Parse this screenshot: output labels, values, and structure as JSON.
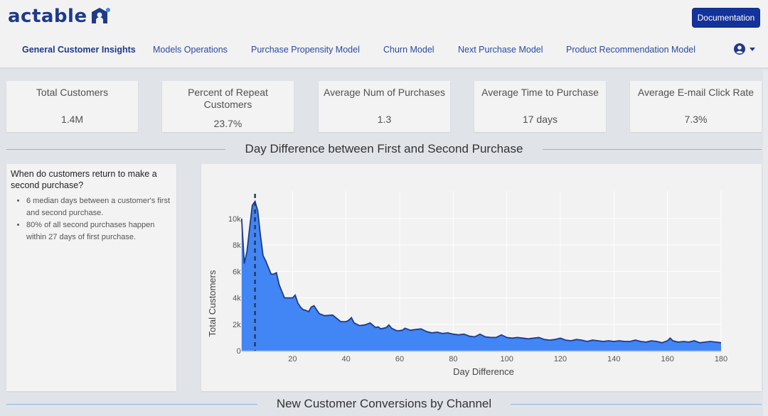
{
  "header": {
    "logo_text": "actable",
    "logo_icon": "house-person-icon",
    "documentation_label": "Documentation",
    "brand_color": "#1e3a8a",
    "button_color": "#14339a"
  },
  "nav": {
    "items": [
      {
        "label": "General Customer Insights",
        "active": true
      },
      {
        "label": "Models Operations",
        "active": false
      },
      {
        "label": "Purchase Propensity Model",
        "active": false
      },
      {
        "label": "Churn Model",
        "active": false
      },
      {
        "label": "Next Purchase Model",
        "active": false
      },
      {
        "label": "Product Recommendation Model",
        "active": false
      }
    ],
    "user_icon": "user-circle-icon"
  },
  "kpis": [
    {
      "title": "Total Customers",
      "value": "1.4M"
    },
    {
      "title": "Percent of Repeat Customers",
      "value": "23.7%"
    },
    {
      "title": "Average Num of Purchases",
      "value": "1.3"
    },
    {
      "title": "Average Time to Purchase",
      "value": "17 days"
    },
    {
      "title": "Average E-mail Click Rate",
      "value": "7.3%"
    }
  ],
  "sections": {
    "day_difference_title": "Day Difference between First and Second Purchase",
    "conversions_title": "New Customer Conversions by Channel"
  },
  "insights": {
    "question": "When do customers return to make a second purchase?",
    "bullets": [
      "6 median days between a customer's first and second purchase.",
      "80% of all second purchases happen within 27 days of first purchase."
    ]
  },
  "chart_data": {
    "type": "area",
    "title": "Day Difference between First and Second Purchase",
    "xlabel": "Day Difference",
    "ylabel": "Total Customers",
    "xlim": [
      0,
      180
    ],
    "ylim": [
      0,
      11500
    ],
    "x_ticks": [
      20,
      40,
      60,
      80,
      100,
      120,
      140,
      160,
      180
    ],
    "y_ticks": [
      0,
      2000,
      4000,
      6000,
      8000,
      10000
    ],
    "y_tick_labels": [
      "0",
      "2k",
      "4k",
      "6k",
      "8k",
      "10k"
    ],
    "grid": true,
    "fill_color": "#4285f4",
    "line_color": "#1e3a8a",
    "median_line": {
      "x": 6,
      "style": "dashed",
      "color": "#2b3a55"
    },
    "series": [
      {
        "name": "Total Customers",
        "x": [
          1,
          2,
          3,
          4,
          5,
          6,
          7,
          8,
          9,
          10,
          11,
          12,
          13,
          14,
          15,
          16,
          17,
          18,
          19,
          20,
          21,
          22,
          23,
          24,
          25,
          26,
          27,
          28,
          29,
          30,
          32,
          35,
          38,
          40,
          41,
          42,
          43,
          45,
          47,
          49,
          51,
          52,
          53,
          55,
          56,
          57,
          59,
          61,
          62,
          64,
          66,
          68,
          70,
          72,
          74,
          76,
          78,
          80,
          82,
          84,
          86,
          88,
          90,
          92,
          94,
          96,
          98,
          100,
          102,
          104,
          106,
          108,
          110,
          112,
          114,
          116,
          118,
          120,
          122,
          124,
          126,
          128,
          130,
          132,
          134,
          136,
          138,
          140,
          142,
          144,
          146,
          148,
          150,
          152,
          154,
          156,
          158,
          160,
          161,
          162,
          164,
          166,
          168,
          170,
          172,
          174,
          176,
          178,
          180
        ],
        "y": [
          10000,
          6600,
          7500,
          9300,
          11000,
          11300,
          10600,
          8800,
          7200,
          6800,
          6300,
          5800,
          5800,
          5900,
          5000,
          4500,
          4000,
          4000,
          4000,
          4000,
          4200,
          3600,
          3300,
          3100,
          3050,
          2950,
          3300,
          3400,
          3100,
          2800,
          2650,
          2700,
          2200,
          2200,
          2300,
          2500,
          2100,
          1900,
          1950,
          2100,
          1750,
          1800,
          1650,
          1750,
          1950,
          1700,
          1500,
          1550,
          1700,
          1550,
          1600,
          1650,
          1450,
          1350,
          1400,
          1300,
          1350,
          1250,
          1200,
          1250,
          1100,
          1050,
          1250,
          1050,
          1000,
          1000,
          1200,
          1000,
          950,
          1000,
          950,
          900,
          950,
          1000,
          850,
          800,
          850,
          950,
          800,
          750,
          850,
          800,
          700,
          800,
          750,
          700,
          750,
          700,
          750,
          700,
          700,
          800,
          700,
          650,
          750,
          700,
          600,
          750,
          950,
          750,
          650,
          700,
          650,
          750,
          600,
          650,
          700,
          650,
          600
        ]
      }
    ]
  }
}
